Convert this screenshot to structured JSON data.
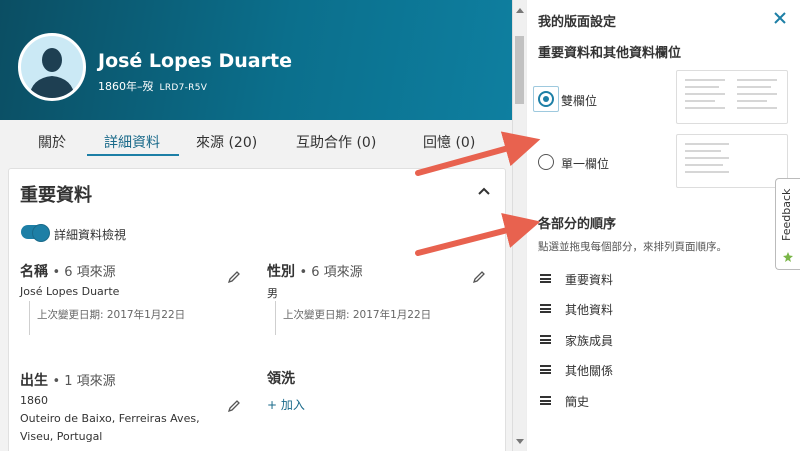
{
  "person": {
    "name": "José Lopes Duarte",
    "dates": "1860年–歿",
    "id": "LRD7-R5V"
  },
  "tabs": [
    {
      "label": "關於"
    },
    {
      "label": "詳細資料"
    },
    {
      "label": "來源 (20)"
    },
    {
      "label": "互助合作 (0)"
    },
    {
      "label": "回憶 (0)"
    }
  ],
  "card": {
    "title": "重要資料",
    "toggle_label": "詳細資料檢視",
    "name_field": {
      "title": "名稱",
      "sources": "• 6 項來源",
      "value": "José Lopes Duarte",
      "changed": "上次變更日期: 2017年1月22日"
    },
    "sex_field": {
      "title": "性別",
      "sources": "• 6 項來源",
      "value": "男",
      "changed": "上次變更日期: 2017年1月22日"
    },
    "birth_field": {
      "title": "出生",
      "sources": "• 1 項來源",
      "value1": "1860",
      "value2": "Outeiro de Baixo, Ferreiras Aves,",
      "value3": "Viseu, Portugal"
    },
    "christening_field": {
      "title": "領洗",
      "add": "+ 加入"
    }
  },
  "panel": {
    "title": "我的版面設定",
    "layout_section": "重要資料和其他資料欄位",
    "option_two": "雙欄位",
    "option_one": "單一欄位",
    "order_section": "各部分的順序",
    "order_hint": "點選並拖曳每個部分，來排列頁面順序。",
    "order_items": [
      {
        "label": "重要資料"
      },
      {
        "label": "其他資料"
      },
      {
        "label": "家族成員"
      },
      {
        "label": "其他關係"
      },
      {
        "label": "簡史"
      }
    ]
  },
  "feedback": {
    "label": "Feedback"
  },
  "colors": {
    "accent": "#1d7fa6",
    "hero": "#0b6f8c",
    "arrow": "#e8624f"
  },
  "icons": [
    "avatar",
    "pencil-icon",
    "chevron-up-icon",
    "close-icon",
    "drag-handle-icon",
    "feedback-icon"
  ]
}
